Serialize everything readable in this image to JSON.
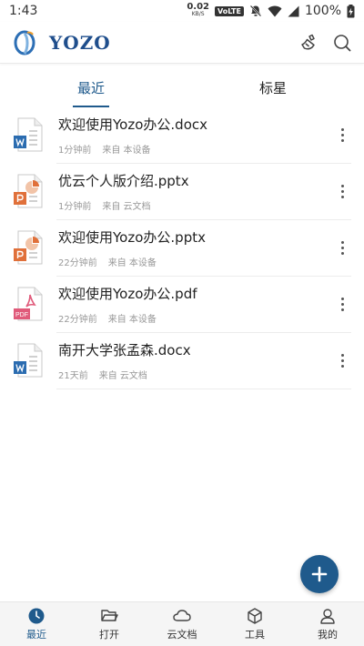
{
  "status": {
    "time": "1:43",
    "speed_value": "0.02",
    "speed_unit": "KB/S",
    "volte": "VoLTE",
    "battery": "100%"
  },
  "header": {
    "logo_text": "YOZO"
  },
  "tabs": [
    {
      "label": "最近"
    },
    {
      "label": "标星"
    }
  ],
  "files": [
    {
      "type": "word",
      "name": "欢迎使用Yozo办公.docx",
      "time": "1分钟前",
      "source": "来自 本设备"
    },
    {
      "type": "ppt",
      "name": "优云个人版介绍.pptx",
      "time": "1分钟前",
      "source": "来自 云文档"
    },
    {
      "type": "ppt",
      "name": "欢迎使用Yozo办公.pptx",
      "time": "22分钟前",
      "source": "来自 本设备"
    },
    {
      "type": "pdf",
      "name": "欢迎使用Yozo办公.pdf",
      "time": "22分钟前",
      "source": "来自 本设备"
    },
    {
      "type": "word",
      "name": "南开大学张孟森.docx",
      "time": "21天前",
      "source": "来自 云文档"
    }
  ],
  "nav": [
    {
      "label": "最近"
    },
    {
      "label": "打开"
    },
    {
      "label": "云文档"
    },
    {
      "label": "工具"
    },
    {
      "label": "我的"
    }
  ],
  "colors": {
    "accent": "#1f5a8c",
    "word": "#2b6cb0",
    "ppt": "#e0703a",
    "pdf": "#e05a7a"
  }
}
